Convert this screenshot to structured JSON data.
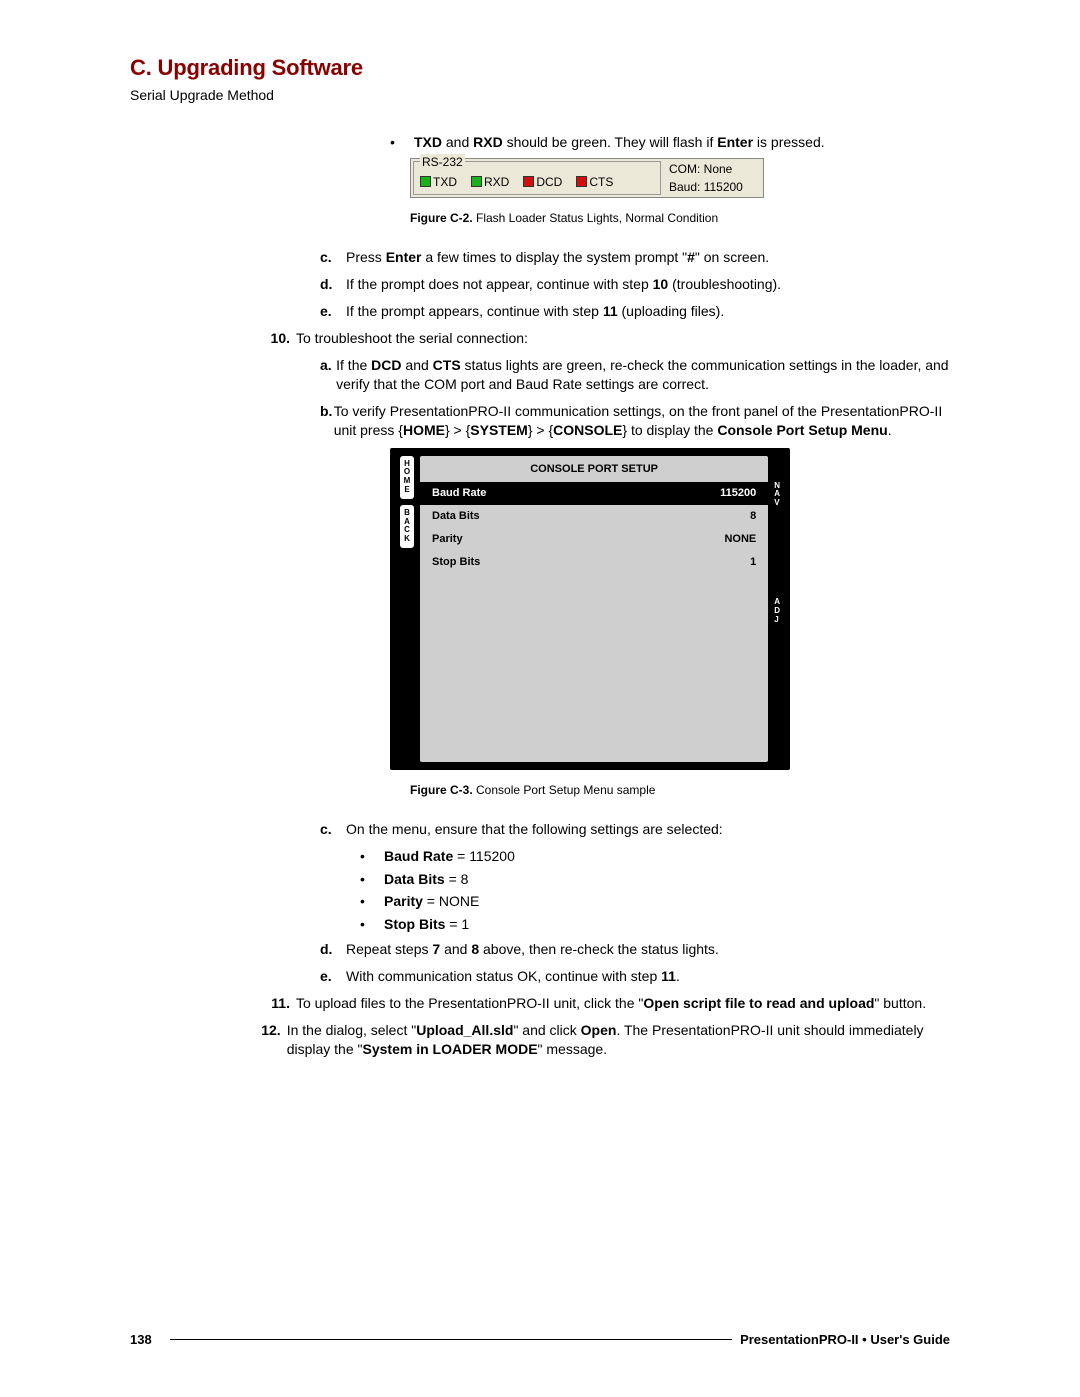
{
  "header": {
    "section_title": "C. Upgrading Software",
    "subtitle": "Serial Upgrade Method"
  },
  "intro_bullet": {
    "pre": "",
    "b1": "TXD",
    "mid1": " and ",
    "b2": "RXD",
    "mid2": " should be green.  They will flash if ",
    "b3": "Enter",
    "post": " is pressed."
  },
  "rs232": {
    "legend": "RS-232",
    "lights": [
      {
        "label": "TXD",
        "color": "green"
      },
      {
        "label": "RXD",
        "color": "green"
      },
      {
        "label": "DCD",
        "color": "red"
      },
      {
        "label": "CTS",
        "color": "red"
      }
    ],
    "com": "COM: None",
    "baud": "Baud: 115200"
  },
  "fig2": {
    "label": "Figure C-2.",
    "text": "  Flash Loader Status Lights, Normal Condition"
  },
  "letters1": {
    "c": {
      "marker": "c.",
      "pre": "Press ",
      "b1": "Enter",
      "mid": " a few times to display the system prompt \"",
      "b2": "#",
      "post": "\" on screen."
    },
    "d": {
      "marker": "d.",
      "pre": "If the prompt does not appear, continue with step ",
      "b1": "10",
      "post": " (troubleshooting)."
    },
    "e": {
      "marker": "e.",
      "pre": "If the prompt appears, continue with step ",
      "b1": "11",
      "post": " (uploading files)."
    }
  },
  "step10": {
    "marker": "10.",
    "text": "To troubleshoot the serial connection:",
    "a": {
      "marker": "a.",
      "pre": "If the ",
      "b1": "DCD",
      "mid1": " and ",
      "b2": "CTS",
      "post": " status lights are green, re-check the communication settings in the loader, and verify that the COM port and Baud Rate settings are correct."
    },
    "b": {
      "marker": "b.",
      "pre": "To verify PresentationPRO-II communication settings, on the front panel of the PresentationPRO-II unit press {",
      "b1": "HOME",
      "mid1": "} > {",
      "b2": "SYSTEM",
      "mid2": "} > {",
      "b3": "CONSOLE",
      "mid3": "} to display the ",
      "b4": "Console Port Setup Menu",
      "post": "."
    }
  },
  "console": {
    "title": "CONSOLE PORT SETUP",
    "left_tabs": [
      "HOME",
      "BACK"
    ],
    "right_tabs": [
      "NAV",
      "ADJ"
    ],
    "rows": [
      {
        "label": "Baud Rate",
        "value": "115200",
        "selected": true
      },
      {
        "label": "Data Bits",
        "value": "8",
        "selected": false
      },
      {
        "label": "Parity",
        "value": "NONE",
        "selected": false
      },
      {
        "label": "Stop Bits",
        "value": "1",
        "selected": false
      }
    ]
  },
  "fig3": {
    "label": "Figure C-3.",
    "text": "  Console Port Setup Menu  sample"
  },
  "letters2": {
    "c": {
      "marker": "c.",
      "text": "On the menu, ensure that the following settings are selected:"
    },
    "settings": [
      {
        "b": "Baud Rate",
        "rest": " = 115200"
      },
      {
        "b": "Data Bits",
        "rest": " = 8"
      },
      {
        "b": "Parity",
        "rest": " = NONE"
      },
      {
        "b": "Stop Bits",
        "rest": " = 1"
      }
    ],
    "d": {
      "marker": "d.",
      "pre": "Repeat steps ",
      "b1": "7",
      "mid": " and ",
      "b2": "8",
      "post": " above, then re-check the status lights."
    },
    "e": {
      "marker": "e.",
      "pre": "With communication status OK, continue with step ",
      "b1": "11",
      "post": "."
    }
  },
  "step11": {
    "marker": "11.",
    "pre": "To upload files to the PresentationPRO-II unit, click the \"",
    "b1": "Open script file to read and upload",
    "post": "\" button."
  },
  "step12": {
    "marker": "12.",
    "pre": "In the dialog, select \"",
    "b1": "Upload_All.sld",
    "mid1": "\" and click ",
    "b2": "Open",
    "mid2": ".  The PresentationPRO-II unit should immediately display the \"",
    "b3": "System in LOADER MODE",
    "post": "\" message."
  },
  "footer": {
    "page": "138",
    "guide": "PresentationPRO-II  •  User's Guide"
  }
}
